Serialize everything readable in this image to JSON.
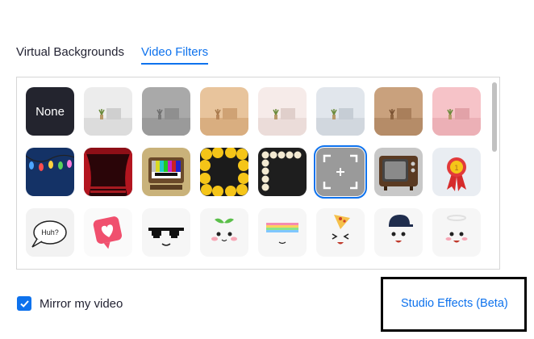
{
  "tabs": [
    {
      "label": "Virtual Backgrounds",
      "active": false
    },
    {
      "label": "Video Filters",
      "active": true
    }
  ],
  "filters": {
    "none_label": "None",
    "speech_bubble_text": "Huh?",
    "row1": [
      "none",
      "room-light-gray",
      "room-gray",
      "room-tan",
      "room-pink-white",
      "room-blue-gray",
      "room-brown",
      "room-pink"
    ],
    "row2": [
      "string-lights",
      "theater-curtain",
      "retro-tv-color-bars",
      "emoji-frame",
      "bulb-frame",
      "camera-frame",
      "retro-tv",
      "award-ribbon"
    ],
    "row3": [
      "speech-bubble",
      "heart-like",
      "pixel-sunglasses",
      "sprout-face",
      "rainbow-face",
      "pizza-face",
      "cap-face",
      "halo-face"
    ],
    "selected": "camera-frame"
  },
  "mirror": {
    "label": "Mirror my video",
    "checked": true
  },
  "studio_effects": {
    "label": "Studio Effects (Beta)"
  },
  "colors": {
    "accent": "#0e72ed",
    "none_tile": "#23242e"
  }
}
